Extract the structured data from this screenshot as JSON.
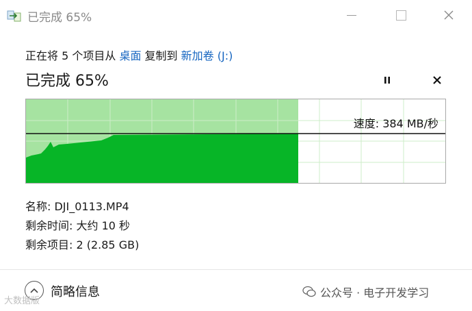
{
  "window": {
    "title": "已完成 65%",
    "controls": [
      "minimize",
      "maximize",
      "close"
    ]
  },
  "copy": {
    "prefix": "正在将 5 个项目从 ",
    "source": "桌面",
    "middle": " 复制到 ",
    "destination": "新加卷 (J:)"
  },
  "progress": {
    "title": "已完成 65%",
    "percent": 65,
    "speed_label": "速度: 384 MB/秒"
  },
  "details": {
    "name": "名称: DJI_0113.MP4",
    "time_left": "剩余时间: 大约 10 秒",
    "items_left": "剩余项目: 2 (2.85 GB)"
  },
  "footer": {
    "less_details": "简略信息",
    "watermark": "公众号 · 电子开发学习",
    "corner_watermark": "大数据版"
  },
  "colors": {
    "progress_light": "#a6e3a1",
    "progress_dark": "#07b527",
    "grid": "#cdecc9",
    "link": "#1565c0"
  },
  "icons": [
    "copy-transfer-icon",
    "minimize-icon",
    "maximize-icon",
    "close-icon",
    "pause-icon",
    "cancel-icon",
    "chevron-up-icon",
    "wechat-icon"
  ]
}
